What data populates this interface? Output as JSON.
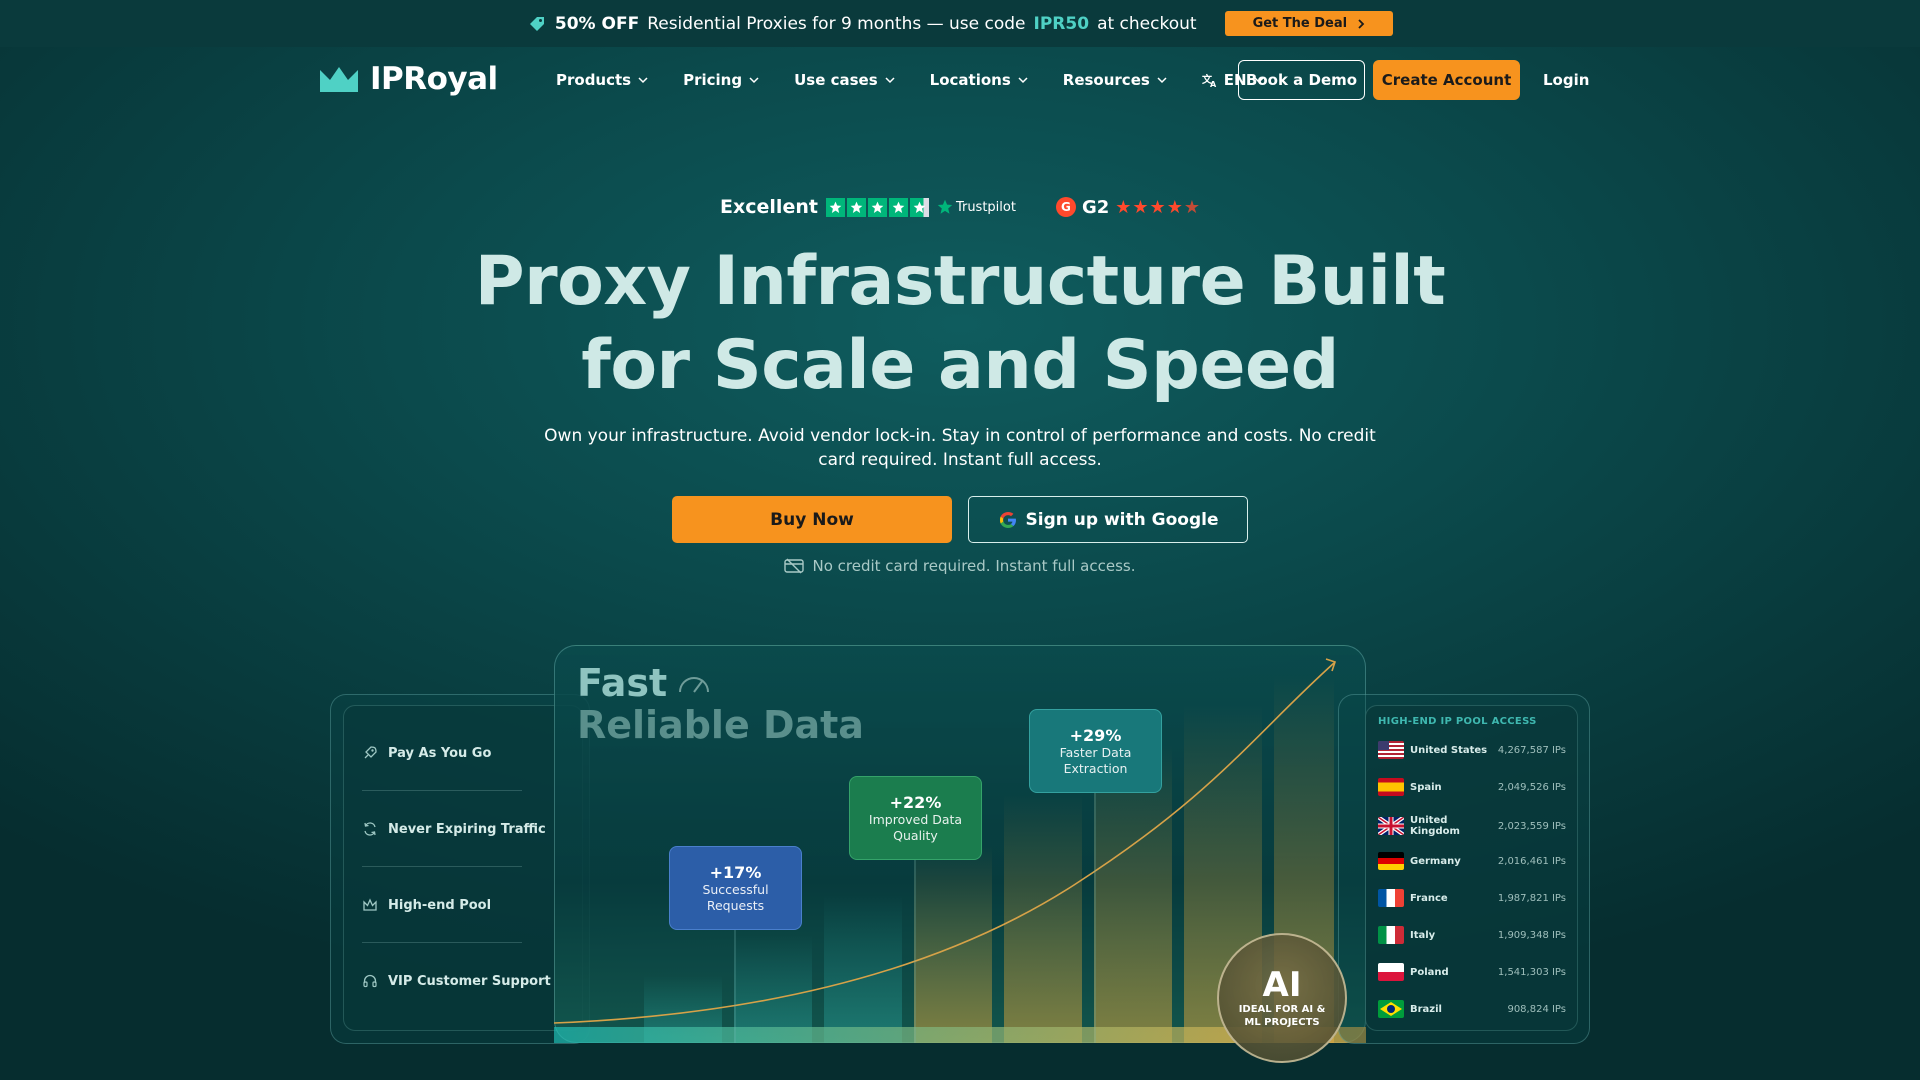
{
  "promo": {
    "bold": "50% OFF",
    "text": "Residential Proxies for 9 months — use code",
    "code": "IPR50",
    "suffix": "at checkout",
    "button": "Get The Deal"
  },
  "nav": {
    "logo": "IPRoyal",
    "items": [
      {
        "label": "Products"
      },
      {
        "label": "Pricing"
      },
      {
        "label": "Use cases"
      },
      {
        "label": "Locations"
      },
      {
        "label": "Resources"
      },
      {
        "label": "EN"
      }
    ],
    "book_demo": "Book a Demo",
    "create_account": "Create Account",
    "login": "Login"
  },
  "ratings": {
    "trustpilot_label": "Excellent",
    "trustpilot_brand": "Trustpilot",
    "g2_label": "G2"
  },
  "hero": {
    "title_line1": "Proxy Infrastructure Built",
    "title_line2": "for Scale and Speed",
    "subtitle": "Own your infrastructure. Avoid vendor lock-in. Stay in control of performance and costs. No credit card required. Instant full access.",
    "buy_now": "Buy Now",
    "google_signup": "Sign up with Google",
    "note": "No credit card required. Instant full access."
  },
  "features": [
    {
      "label": "Pay As You Go",
      "icon": "rocket-icon"
    },
    {
      "label": "Never Expiring Traffic",
      "icon": "refresh-icon"
    },
    {
      "label": "High-end Pool",
      "icon": "crown-icon"
    },
    {
      "label": "VIP Customer Support",
      "icon": "headset-icon"
    }
  ],
  "chart": {
    "title_line1": "Fast",
    "title_line2": "Reliable Data",
    "stats": [
      {
        "pct": "+17%",
        "label": "Successful Requests"
      },
      {
        "pct": "+22%",
        "label": "Improved Data Quality"
      },
      {
        "pct": "+29%",
        "label": "Faster Data Extraction"
      }
    ],
    "ai_title": "AI",
    "ai_label": "IDEAL FOR AI & ML PROJECTS"
  },
  "pool": {
    "title": "HIGH-END IP POOL ACCESS",
    "rows": [
      {
        "country": "United States",
        "ips": "4,267,587 IPs"
      },
      {
        "country": "Spain",
        "ips": "2,049,526 IPs"
      },
      {
        "country": "United Kingdom",
        "ips": "2,023,559 IPs"
      },
      {
        "country": "Germany",
        "ips": "2,016,461 IPs"
      },
      {
        "country": "France",
        "ips": "1,987,821 IPs"
      },
      {
        "country": "Italy",
        "ips": "1,909,348 IPs"
      },
      {
        "country": "Poland",
        "ips": "1,541,303 IPs"
      },
      {
        "country": "Brazil",
        "ips": "908,824 IPs"
      }
    ]
  },
  "colors": {
    "accent": "#f7931e",
    "teal": "#4fd1c5",
    "trustpilot": "#00b67a",
    "g2": "#ff492c"
  }
}
